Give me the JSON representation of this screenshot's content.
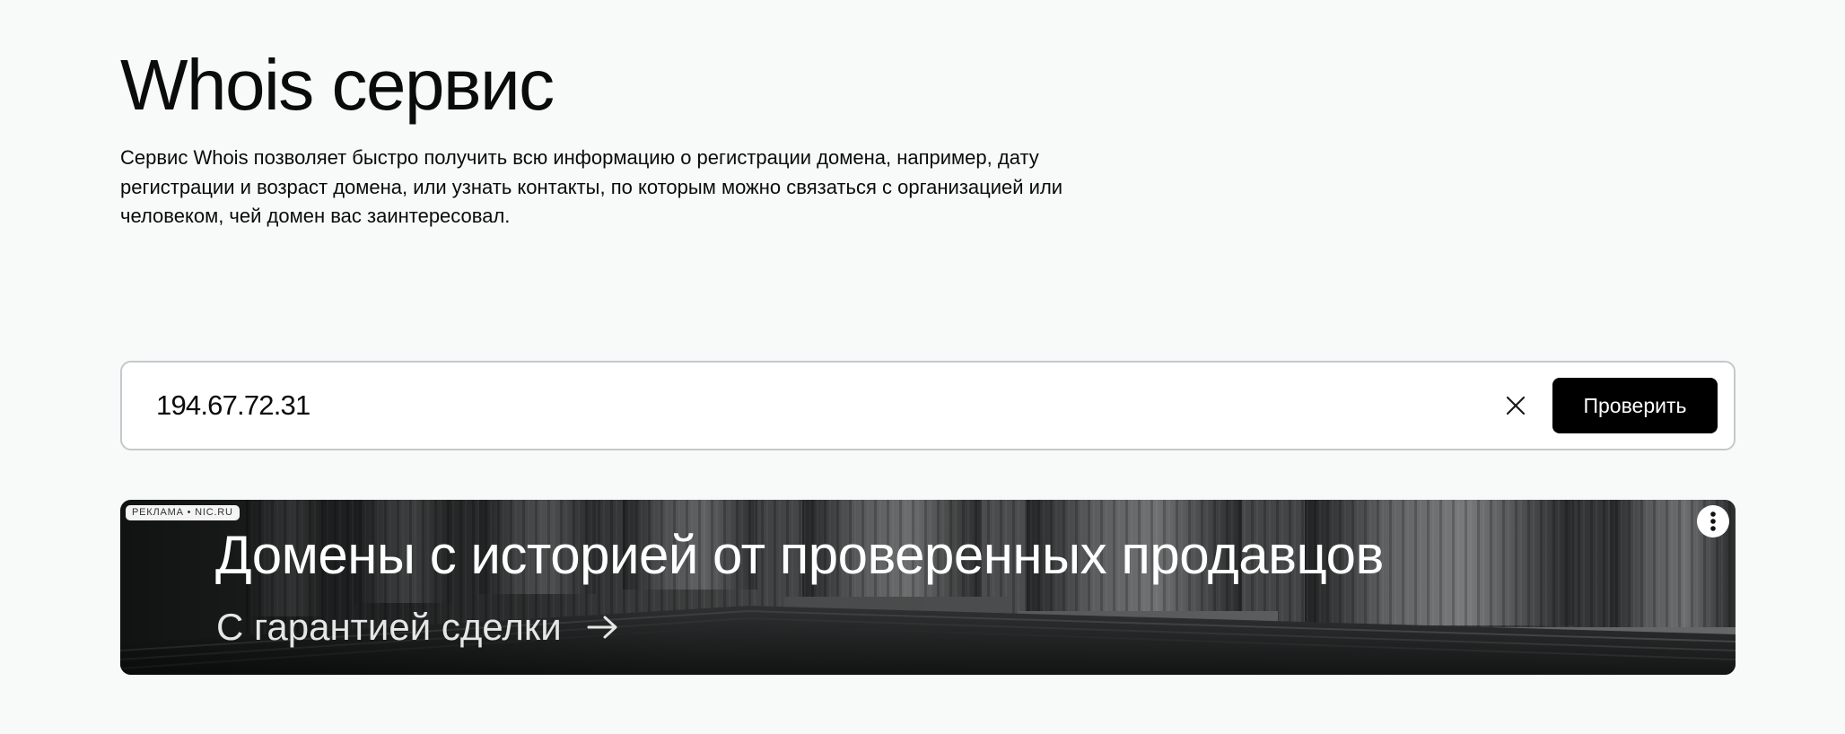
{
  "page": {
    "title": "Whois сервис",
    "description": "Сервис Whois позволяет быстро получить всю информацию о регистрации домена, например, дату регистрации и возраст домена, или узнать контакты, по которым можно связаться с организацией или человеком, чей домен вас заинтересовал."
  },
  "search": {
    "value": "194.67.72.31",
    "clear_icon": "close-icon",
    "submit_label": "Проверить"
  },
  "ad": {
    "label": "РЕКЛАМА • NIC.RU",
    "headline": "Домены с историей от проверенных продавцов",
    "subline": "С гарантией сделки",
    "arrow_icon": "arrow-right-icon",
    "menu_icon": "more-vertical-icon"
  },
  "colors": {
    "background": "#f8f9f9",
    "text": "#0b0b0b",
    "button_background": "#000000",
    "button_text": "#ffffff",
    "input_border": "#c4c8cc"
  }
}
